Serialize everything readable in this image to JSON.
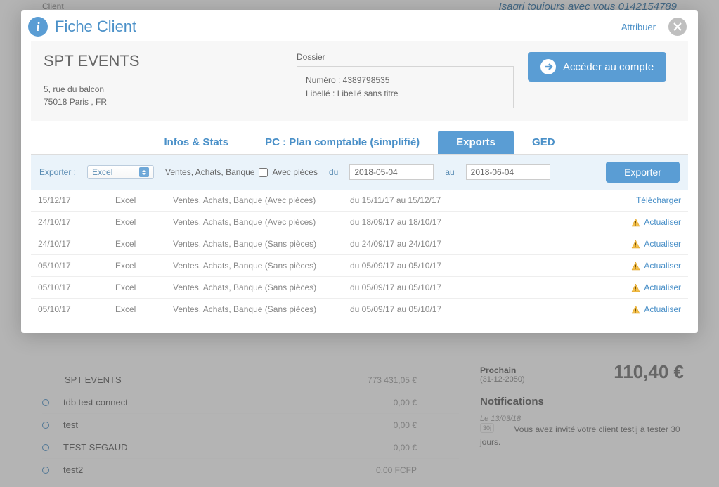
{
  "bg": {
    "client_label": "Client",
    "slogan": "Isagri toujours avec vous 0142154789",
    "rows": [
      {
        "name": "SPT EVENTS",
        "amount": "773 431,05 €"
      },
      {
        "name": "tdb test connect",
        "amount": "0,00 €"
      },
      {
        "name": "test",
        "amount": "0,00 €"
      },
      {
        "name": "TEST SEGAUD",
        "amount": "0,00 €"
      },
      {
        "name": "test2",
        "amount": "0,00 FCFP"
      }
    ],
    "prochain": {
      "label": "Prochain",
      "date": "(31-12-2050)",
      "amount": "110,40 €"
    },
    "notifications": {
      "title": "Notifications",
      "date": "Le 13/03/18",
      "badge": "30j",
      "text": "Vous avez invité votre client testij à tester 30 jours."
    }
  },
  "modal": {
    "title": "Fiche Client",
    "attribuer": "Attribuer",
    "client_name": "SPT EVENTS",
    "address_line1": "5, rue du balcon",
    "address_line2": "75018 Paris , FR",
    "dossier_label": "Dossier",
    "dossier_num": "Numéro : 4389798535",
    "dossier_lib": "Libellé : Libellé sans titre",
    "acces_btn": "Accéder au compte",
    "tabs": [
      {
        "label": "Infos & Stats"
      },
      {
        "label": "PC : Plan comptable (simplifié)"
      },
      {
        "label": "Exports"
      },
      {
        "label": "GED"
      }
    ],
    "active_tab": 2,
    "export_bar": {
      "exporter_label": "Exporter :",
      "format": "Excel",
      "types": "Ventes, Achats, Banque",
      "pieces_label": "Avec pièces",
      "du_label": "du",
      "date_from": "2018-05-04",
      "au_label": "au",
      "date_to": "2018-06-04",
      "exporter_btn": "Exporter"
    },
    "exports": [
      {
        "date": "15/12/17",
        "format": "Excel",
        "types": "Ventes, Achats, Banque (Avec pièces)",
        "range": "du 15/11/17 au 15/12/17",
        "action": "Télécharger",
        "warn": false
      },
      {
        "date": "24/10/17",
        "format": "Excel",
        "types": "Ventes, Achats, Banque (Avec pièces)",
        "range": "du 18/09/17 au 18/10/17",
        "action": "Actualiser",
        "warn": true
      },
      {
        "date": "24/10/17",
        "format": "Excel",
        "types": "Ventes, Achats, Banque (Sans pièces)",
        "range": "du 24/09/17 au 24/10/17",
        "action": "Actualiser",
        "warn": true
      },
      {
        "date": "05/10/17",
        "format": "Excel",
        "types": "Ventes, Achats, Banque (Sans pièces)",
        "range": "du 05/09/17 au 05/10/17",
        "action": "Actualiser",
        "warn": true
      },
      {
        "date": "05/10/17",
        "format": "Excel",
        "types": "Ventes, Achats, Banque (Sans pièces)",
        "range": "du 05/09/17 au 05/10/17",
        "action": "Actualiser",
        "warn": true
      },
      {
        "date": "05/10/17",
        "format": "Excel",
        "types": "Ventes, Achats, Banque (Sans pièces)",
        "range": "du 05/09/17 au 05/10/17",
        "action": "Actualiser",
        "warn": true
      }
    ]
  }
}
